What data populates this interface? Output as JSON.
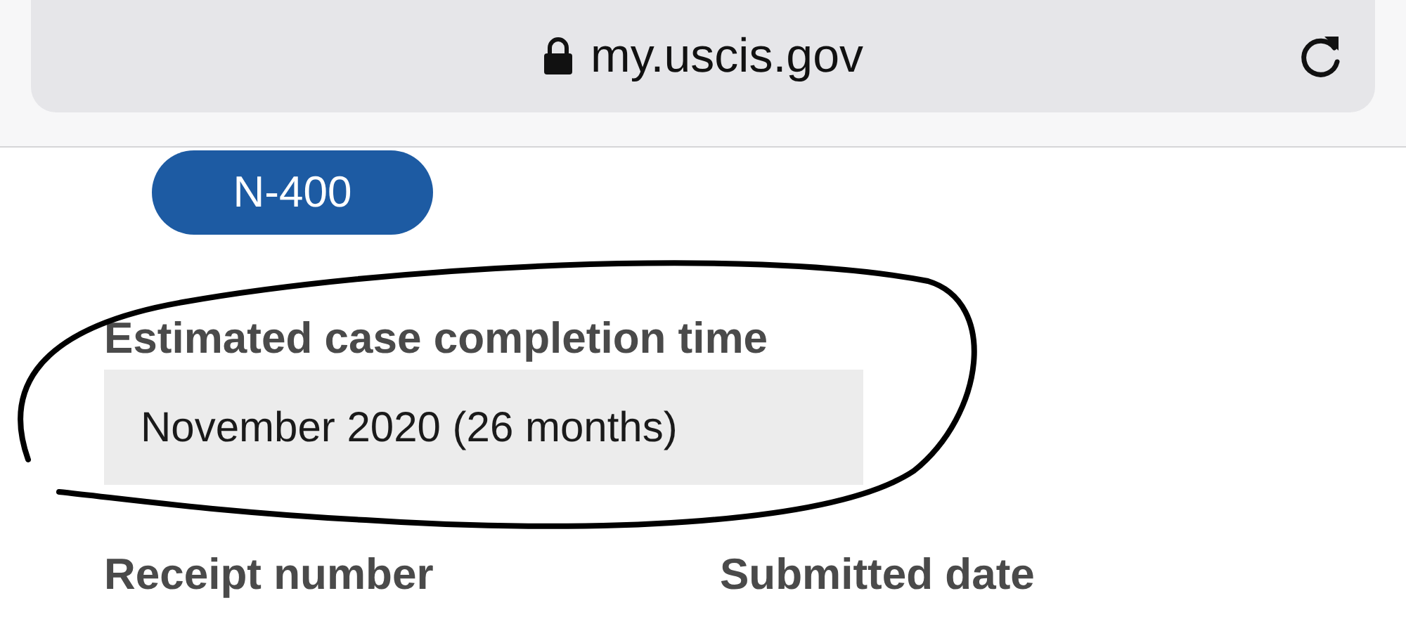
{
  "address_bar": {
    "url": "my.uscis.gov"
  },
  "form_badge": "N-400",
  "estimate": {
    "label": "Estimated case completion time",
    "value": "November 2020 (26 months)"
  },
  "fields": [
    {
      "label": "Receipt number"
    },
    {
      "label": "Submitted date"
    }
  ]
}
